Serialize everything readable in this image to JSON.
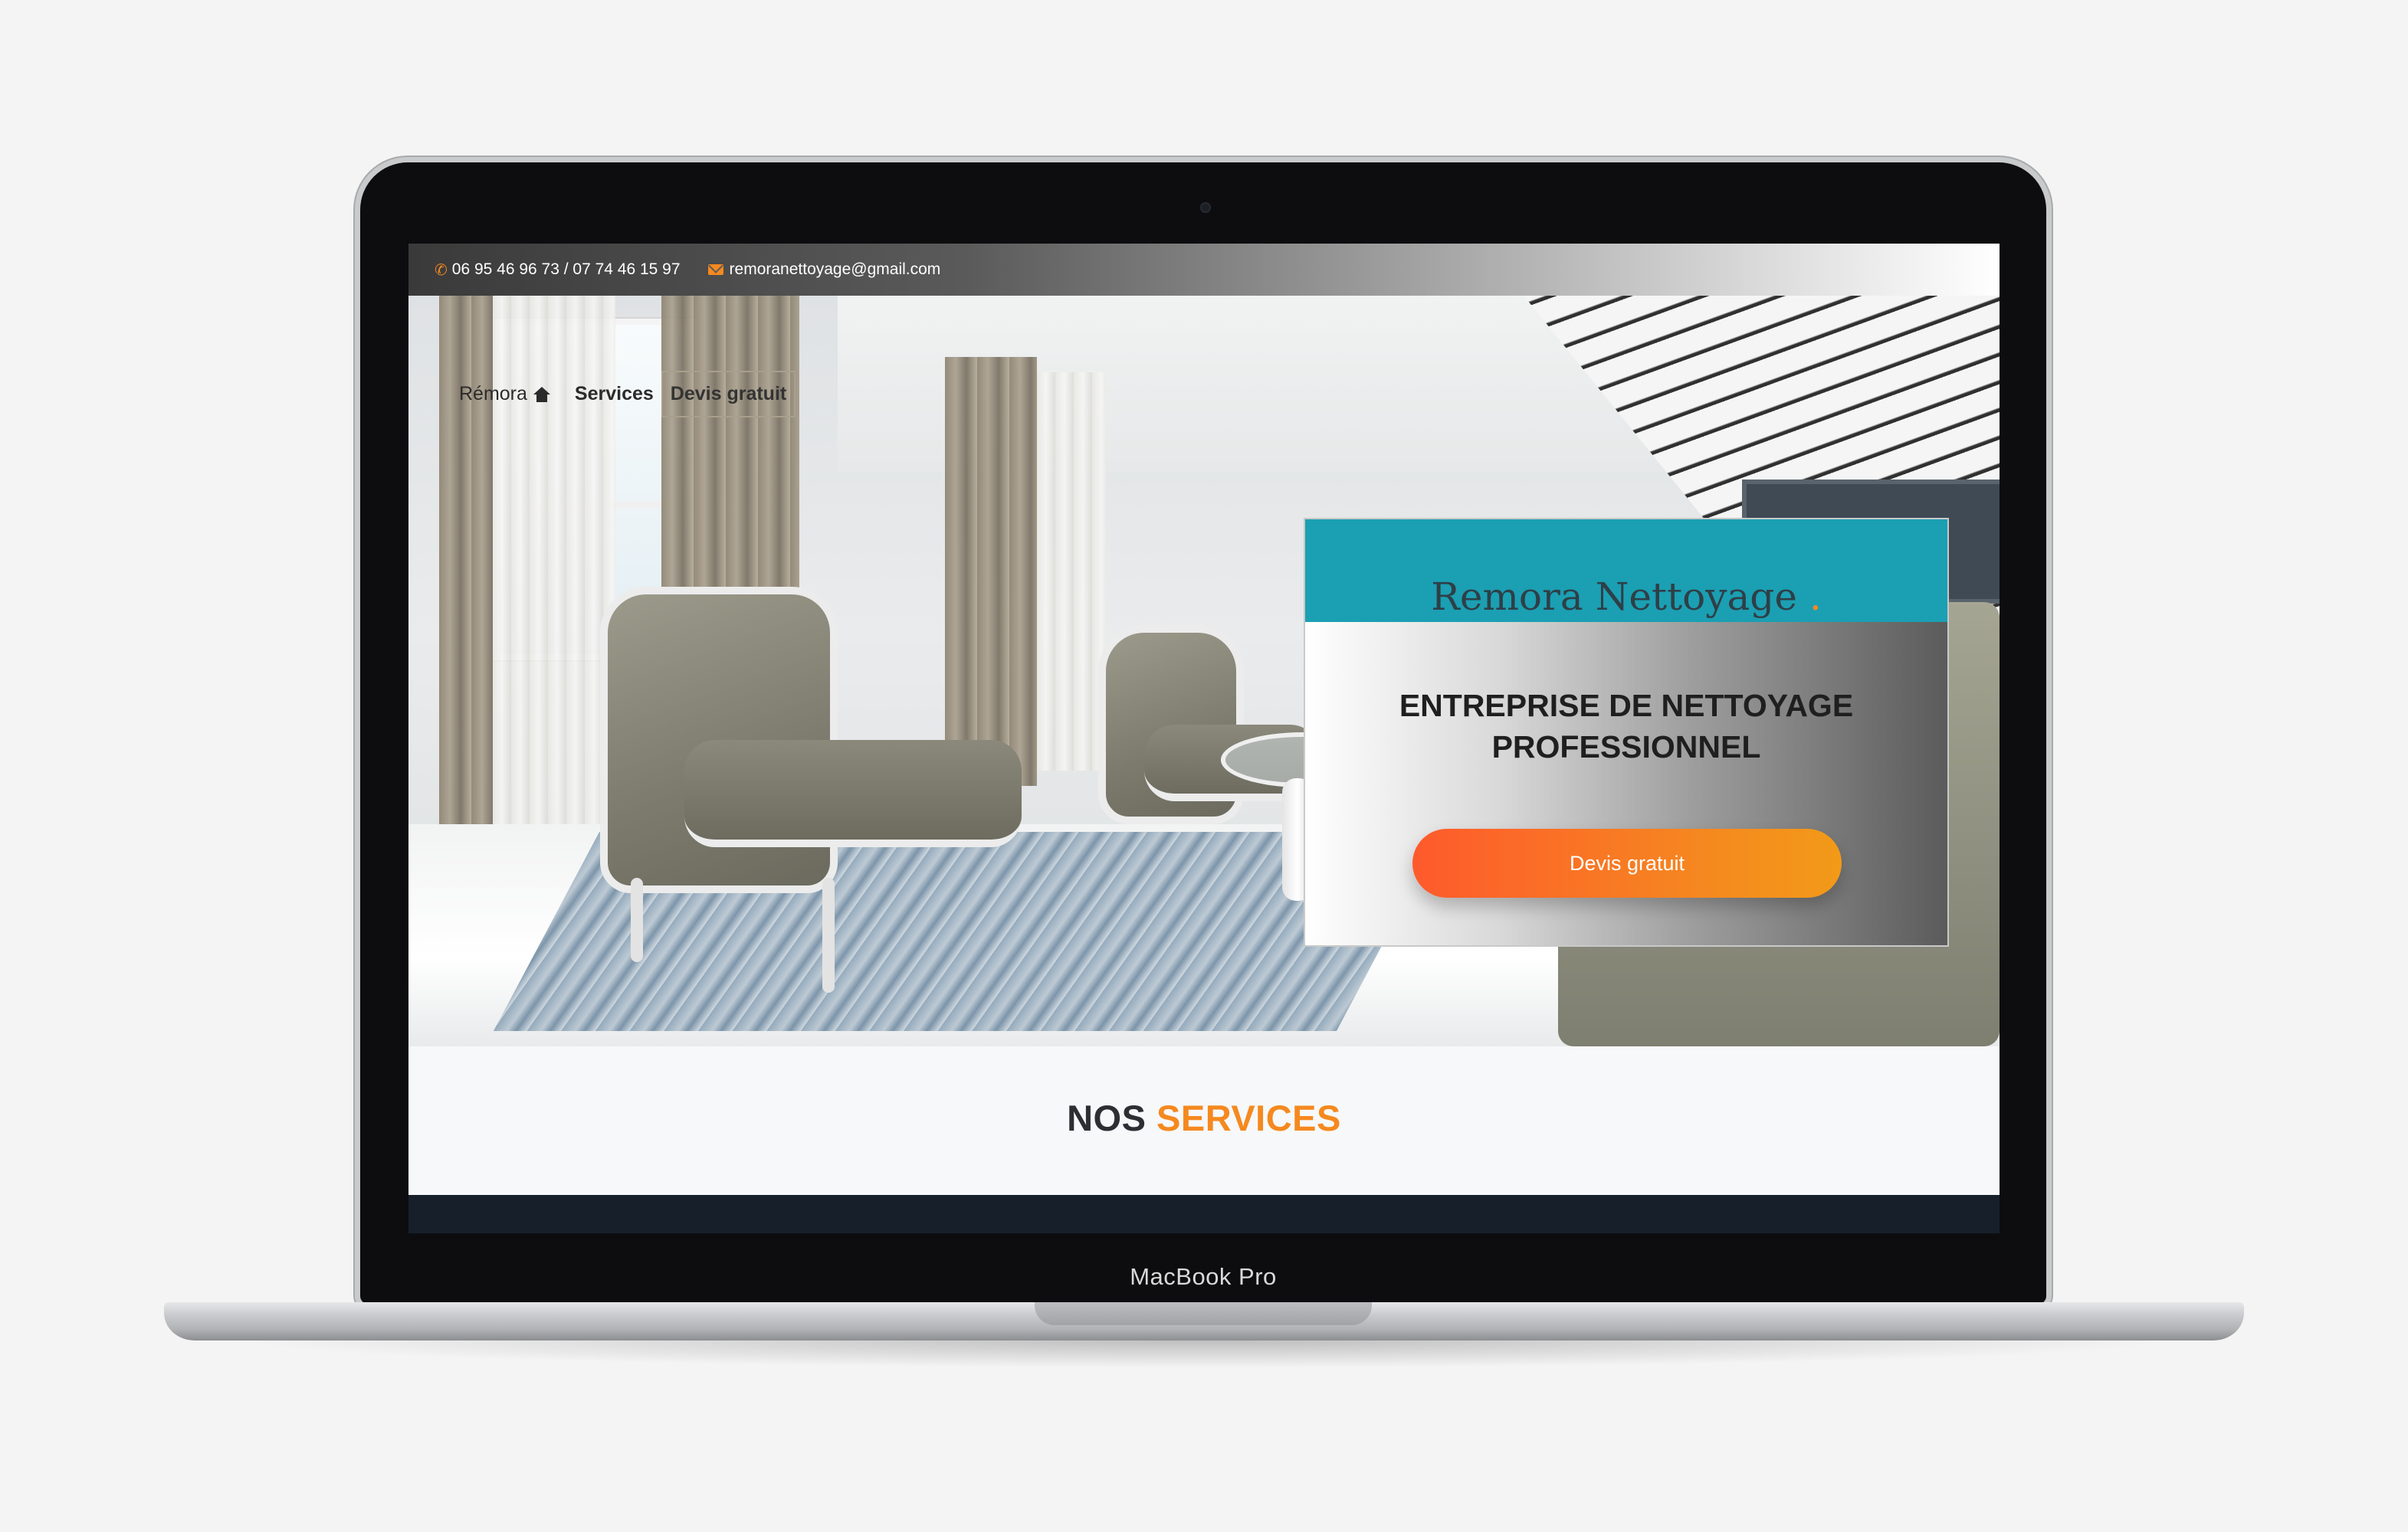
{
  "device": {
    "label": "MacBook Pro"
  },
  "topbar": {
    "phone_icon": "phone-icon",
    "phone": "06 95 46 96 73 / 07 74 46 15 97",
    "email_icon": "envelope-icon",
    "email": "remoranettoyage@gmail.com"
  },
  "nav": {
    "brand": "Rémora",
    "brand_icon": "home-icon",
    "services": "Services",
    "quote": "Devis gratuit"
  },
  "hero": {
    "card_title": "Remora Nettoyage",
    "card_title_dot": ".",
    "heading": "ENTREPRISE DE NETTOYAGE PROFESSIONNEL",
    "cta": "Devis gratuit"
  },
  "services": {
    "title_part1": "NOS",
    "title_part2": "SERVICES"
  },
  "colors": {
    "accent": "#f5891f",
    "teal": "#1b9fb3",
    "cta_start": "#fe5a2c",
    "cta_end": "#f29a18",
    "dark": "#17202a"
  }
}
